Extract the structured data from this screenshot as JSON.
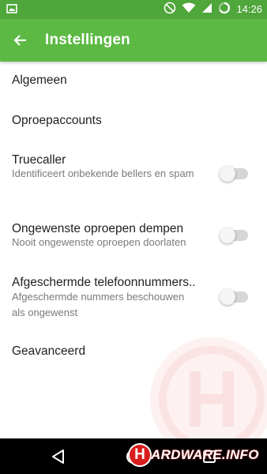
{
  "status_bar": {
    "time": "14:26",
    "icons": [
      "gallery-icon",
      "do-not-disturb-icon",
      "wifi-icon",
      "signal-icon",
      "battery-icon"
    ],
    "background": "#4fa63a"
  },
  "toolbar": {
    "title": "Instellingen",
    "back_icon": "arrow-left-icon",
    "background": "#5cb944"
  },
  "settings": {
    "general": {
      "title": "Algemeen"
    },
    "call_accounts": {
      "title": "Oproepaccounts"
    },
    "truecaller": {
      "title": "Truecaller",
      "subtitle": "Identificeert onbekende bellers en spam",
      "enabled": false
    },
    "mute_unwanted": {
      "title": "Ongewenste oproepen dempen",
      "subtitle": "Nooit ongewenste oproepen doorlaten",
      "enabled": false
    },
    "hidden_numbers": {
      "title": "Afgeschermde telefoonnummers..",
      "subtitle": "Afgeschermde nummers beschouwen als ongewenst",
      "enabled": false
    },
    "advanced": {
      "title": "Geavanceerd"
    }
  },
  "nav_bar": {
    "icons": [
      "back-triangle-icon",
      "home-circle-icon",
      "recents-square-icon"
    ]
  },
  "watermark": {
    "letter": "H",
    "text": "ARDWARE.INFO",
    "brand_color": "#d91e1e"
  }
}
